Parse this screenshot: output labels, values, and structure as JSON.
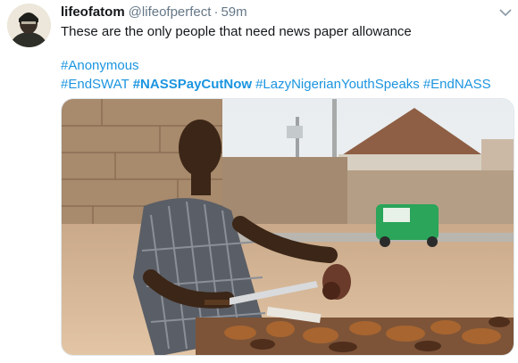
{
  "tweet": {
    "display_name": "lifeofatom",
    "handle": "@lifeofperfect",
    "separator": "·",
    "time": "59m",
    "text": "These are the only people that need news paper allowance",
    "hashtags_line1": [
      "#Anonymous"
    ],
    "hashtags_line2": [
      "#EndSWAT",
      "#NASSPayCutNow",
      "#LazyNigerianYouthSpeaks",
      "#EndNASS"
    ],
    "avatar_icon": "profile-photo",
    "menu_icon": "chevron-down-icon",
    "media_icon": "photo-meat-vendor"
  },
  "colors": {
    "link": "#1b95e0",
    "secondary": "#657786",
    "text": "#14171a"
  }
}
